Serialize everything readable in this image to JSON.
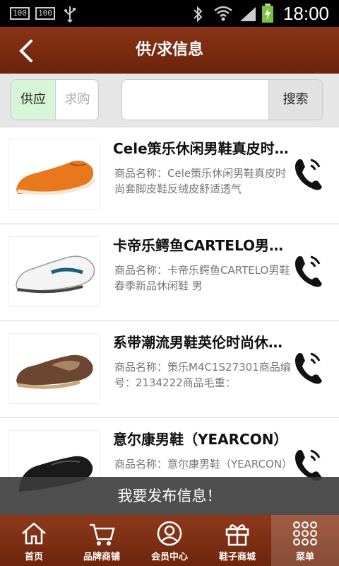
{
  "status_bar": {
    "left_badges": [
      "100",
      "100"
    ],
    "time": "18:00"
  },
  "header": {
    "title": "供/求信息"
  },
  "filter": {
    "tabs": [
      {
        "label": "供应",
        "active": true
      },
      {
        "label": "求购",
        "active": false
      }
    ],
    "search_value": "",
    "search_button": "搜索"
  },
  "items": [
    {
      "title": "Cele策乐休闲男鞋真皮时尚套脚皮鞋反绒皮舒适透气",
      "desc": "商品名称：Cele策乐休闲男鞋真皮时尚套脚皮鞋反绒皮舒适透气",
      "shoe_color": "#e8781e"
    },
    {
      "title": "卡帝乐鳄鱼CARTELO男鞋春季新品休闲鞋",
      "desc": "商品名称：卡帝乐鳄鱼CARTELO男鞋春季新品休闲鞋 男",
      "shoe_color": "#f4f4f4"
    },
    {
      "title": "系带潮流男鞋英伦时尚休闲鞋",
      "desc": "商品名称：策乐M4C1S27301商品编号：2134222商品毛重：",
      "shoe_color": "#6b4630"
    },
    {
      "title": "意尔康男鞋（YEARCON）",
      "desc": "商品名称：意尔康男鞋（YEARCON）",
      "shoe_color": "#1a1a1a"
    }
  ],
  "publish_label": "我要发布信息！",
  "tabbar": {
    "tabs": [
      {
        "label": "首页",
        "icon": "home-icon"
      },
      {
        "label": "品牌商铺",
        "icon": "cart-icon"
      },
      {
        "label": "会员中心",
        "icon": "user-icon"
      },
      {
        "label": "鞋子商城",
        "icon": "gift-icon"
      },
      {
        "label": "菜单",
        "icon": "grid-menu-icon",
        "active": true
      }
    ]
  },
  "colors": {
    "brand": "#7a2c10",
    "active_segment": "#d7f5d7"
  }
}
